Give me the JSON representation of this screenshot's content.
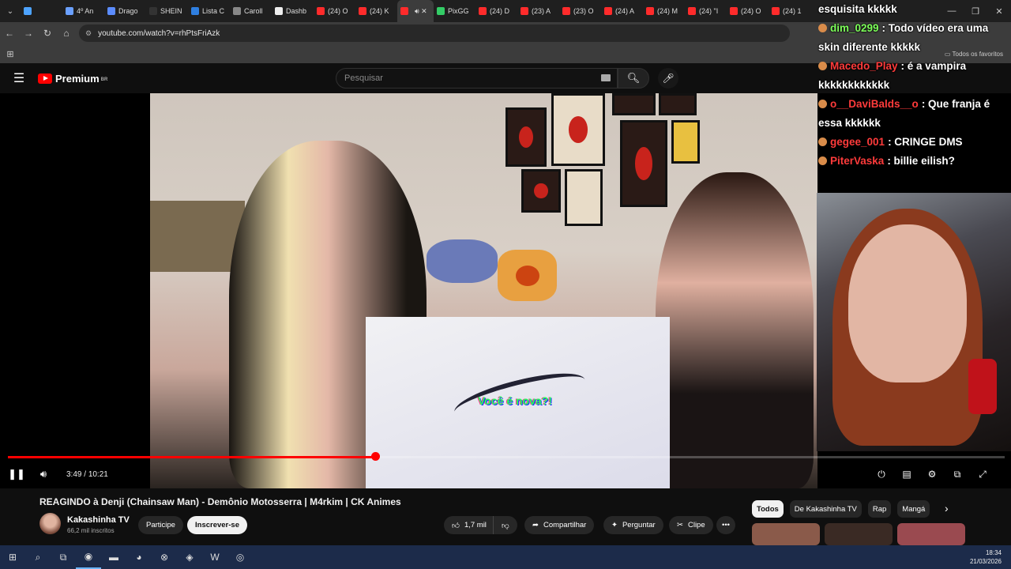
{
  "browser": {
    "tabs": [
      {
        "label": "",
        "color": "#4da3ff"
      },
      {
        "label": "4º An",
        "color": "#6aa0ff"
      },
      {
        "label": "Drago",
        "color": "#5b8cff"
      },
      {
        "label": "SHEIN",
        "color": "#333333"
      },
      {
        "label": "Lista C",
        "color": "#2f7fe0"
      },
      {
        "label": "Caroll",
        "color": "#888888"
      },
      {
        "label": "Dashb",
        "color": "#eeeeee"
      },
      {
        "label": "(24) O",
        "color": "#ff2b2b"
      },
      {
        "label": "(24) K",
        "color": "#ff2b2b"
      },
      {
        "label": "",
        "color": "#ff2b2b",
        "active": true
      },
      {
        "label": "PixGG",
        "color": "#33cc66"
      },
      {
        "label": "(24) D",
        "color": "#ff2b2b"
      },
      {
        "label": "(23) A",
        "color": "#ff2b2b"
      },
      {
        "label": "(23) O",
        "color": "#ff2b2b"
      },
      {
        "label": "(24) A",
        "color": "#ff2b2b"
      },
      {
        "label": "(24) M",
        "color": "#ff2b2b"
      },
      {
        "label": "(24) \"I",
        "color": "#ff2b2b"
      },
      {
        "label": "(24) O",
        "color": "#ff2b2b"
      },
      {
        "label": "(24) 1",
        "color": "#ff2b2b"
      }
    ],
    "url": "youtube.com/watch?v=rhPtsFriAzk",
    "bookmarks_all": "Todos os favoritos"
  },
  "youtube": {
    "logo_text": "Premium",
    "logo_region": "BR",
    "search_placeholder": "Pesquisar"
  },
  "chat": [
    {
      "user": "",
      "user_color": "#ffffff",
      "message": "esquisita kkkkk"
    },
    {
      "user": "dim_0299",
      "user_color": "#7dff5a",
      "message": ": Todo vídeo era uma skin diferente kkkkk"
    },
    {
      "user": "Macedo_Play",
      "user_color": "#ff3b3b",
      "message": ": é a vampira kkkkkkkkkkkk"
    },
    {
      "user": "o__DaviBalds__o",
      "user_color": "#ff3b3b",
      "message": ": Que franja é essa kkkkkk"
    },
    {
      "user": "gegee_001",
      "user_color": "#ff3b3b",
      "message": ": CRINGE DMS"
    },
    {
      "user": "PiterVaska",
      "user_color": "#ff3b3b",
      "message": ": billie eilish?"
    }
  ],
  "player": {
    "current_time": "3:49",
    "duration": "10:21",
    "progress_fraction": 0.3688,
    "clip_subtitle": "Você é nova?!"
  },
  "video": {
    "title": "REAGINDO à Denji (Chainsaw Man) - Demônio Motosserra | M4rkim | CK Animes",
    "channel": "Kakashinha TV",
    "subscribers": "66,2 mil inscritos",
    "join_label": "Participe",
    "subscribe_label": "Inscrever-se",
    "likes": "1,7 mil",
    "share_label": "Compartilhar",
    "ask_label": "Perguntar",
    "clip_label": "Clipe"
  },
  "chips": [
    "Todos",
    "De Kakashinha TV",
    "Rap",
    "Mangá"
  ],
  "taskbar": {
    "time": "18:34",
    "date": "21/03/2026"
  }
}
